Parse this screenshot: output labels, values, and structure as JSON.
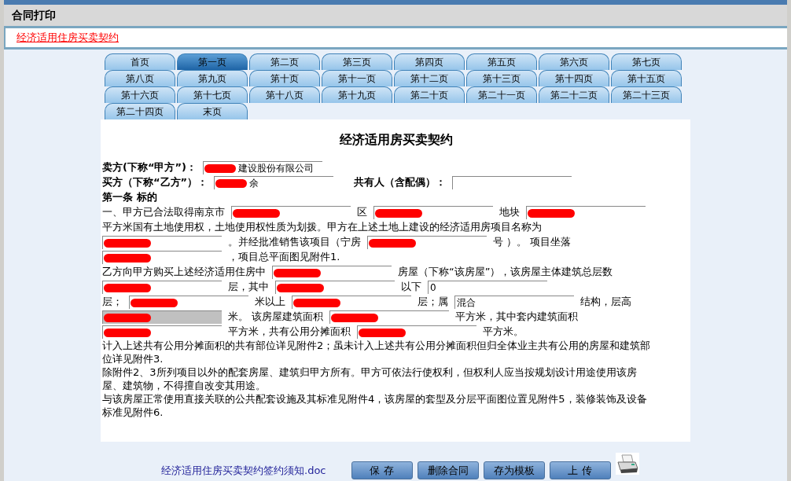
{
  "window": {
    "title": "合同打印"
  },
  "contract_link": "经济适用住房买卖契约",
  "tabs": [
    {
      "label": "首页",
      "selected": false
    },
    {
      "label": "第一页",
      "selected": true
    },
    {
      "label": "第二页",
      "selected": false
    },
    {
      "label": "第三页",
      "selected": false
    },
    {
      "label": "第四页",
      "selected": false
    },
    {
      "label": "第五页",
      "selected": false
    },
    {
      "label": "第六页",
      "selected": false
    },
    {
      "label": "第七页",
      "selected": false
    },
    {
      "label": "第八页",
      "selected": false
    },
    {
      "label": "第九页",
      "selected": false
    },
    {
      "label": "第十页",
      "selected": false
    },
    {
      "label": "第十一页",
      "selected": false
    },
    {
      "label": "第十二页",
      "selected": false
    },
    {
      "label": "第十三页",
      "selected": false
    },
    {
      "label": "第十四页",
      "selected": false
    },
    {
      "label": "第十五页",
      "selected": false
    },
    {
      "label": "第十六页",
      "selected": false
    },
    {
      "label": "第十七页",
      "selected": false
    },
    {
      "label": "第十八页",
      "selected": false
    },
    {
      "label": "第十九页",
      "selected": false
    },
    {
      "label": "第二十页",
      "selected": false
    },
    {
      "label": "第二十一页",
      "selected": false
    },
    {
      "label": "第二十二页",
      "selected": false
    },
    {
      "label": "第二十三页",
      "selected": false
    },
    {
      "label": "第二十四页",
      "selected": false
    },
    {
      "label": "末页",
      "selected": false
    }
  ],
  "document": {
    "title": "经济适用房买卖契约",
    "lines": [
      [
        {
          "kind": "bold",
          "text": "卖方(下称“甲方”)："
        },
        {
          "kind": "field",
          "value": "建设股份有限公司",
          "redacted": true,
          "disabled": false
        }
      ],
      [
        {
          "kind": "bold",
          "text": "买方（下称“乙方”）："
        },
        {
          "kind": "field",
          "value": "余",
          "redacted": true,
          "disabled": false
        },
        {
          "kind": "gap"
        },
        {
          "kind": "bold",
          "text": "共有人（含配偶）："
        },
        {
          "kind": "field",
          "redacted": false,
          "disabled": false
        }
      ],
      [
        {
          "kind": "bold",
          "text": "第一条  标的"
        }
      ],
      [
        {
          "kind": "text",
          "text": "一、甲方已合法取得南京市"
        },
        {
          "kind": "field",
          "redacted": true,
          "disabled": false
        },
        {
          "kind": "text",
          "text": "区"
        },
        {
          "kind": "field",
          "redacted": true,
          "disabled": false
        },
        {
          "kind": "text",
          "text": "地块"
        },
        {
          "kind": "field",
          "redacted": true,
          "disabled": false
        }
      ],
      [
        {
          "kind": "text",
          "text": "平方米国有土地使用权，土地使用权性质为划拨。甲方在上述土地上建设的经济适用房项目名称为"
        }
      ],
      [
        {
          "kind": "field",
          "redacted": true,
          "disabled": false
        },
        {
          "kind": "text",
          "text": "。并经批准销售该项目（宁房"
        },
        {
          "kind": "field",
          "redacted": true,
          "disabled": false
        },
        {
          "kind": "text",
          "text": "号 ）。 项目坐落"
        }
      ],
      [
        {
          "kind": "field",
          "redacted": true,
          "disabled": false
        },
        {
          "kind": "text",
          "text": "，项目总平面图见附件1."
        }
      ],
      [
        {
          "kind": "text",
          "text": "乙方向甲方购买上述经济适用住房中"
        },
        {
          "kind": "field",
          "redacted": true,
          "disabled": false
        },
        {
          "kind": "text",
          "text": "房屋（下称“该房屋”），该房屋主体建筑总层数"
        }
      ],
      [
        {
          "kind": "field",
          "redacted": true,
          "disabled": false
        },
        {
          "kind": "text",
          "text": "层，其中"
        },
        {
          "kind": "field",
          "redacted": true,
          "disabled": false
        },
        {
          "kind": "text",
          "text": "以下"
        },
        {
          "kind": "field",
          "value": "0",
          "redacted": false,
          "disabled": false
        }
      ],
      [
        {
          "kind": "text",
          "text": "层；"
        },
        {
          "kind": "field",
          "redacted": true,
          "disabled": false
        },
        {
          "kind": "text",
          "text": "米以上"
        },
        {
          "kind": "field",
          "redacted": true,
          "disabled": false
        },
        {
          "kind": "text",
          "text": "层；属"
        },
        {
          "kind": "field",
          "value": "混合",
          "redacted": false,
          "disabled": false
        },
        {
          "kind": "text",
          "text": "结构，层高"
        }
      ],
      [
        {
          "kind": "field",
          "redacted": true,
          "disabled": true
        },
        {
          "kind": "text",
          "text": "米。 该房屋建筑面积"
        },
        {
          "kind": "field",
          "redacted": true,
          "disabled": false
        },
        {
          "kind": "text",
          "text": "平方米，其中套内建筑面积"
        }
      ],
      [
        {
          "kind": "field",
          "redacted": true,
          "disabled": false
        },
        {
          "kind": "text",
          "text": "平方米，共有公用分摊面积"
        },
        {
          "kind": "field",
          "redacted": true,
          "disabled": false
        },
        {
          "kind": "text",
          "text": "平方米。"
        }
      ]
    ],
    "paragraphs": [
      "计入上述共有公用分摊面积的共有部位详见附件2；虽未计入上述共有公用分摊面积但归全体业主共有公用的房屋和建筑部位详见附件3.",
      "除附件2、3所列项目以外的配套房屋、建筑归甲方所有。甲方可依法行使权利，但权利人应当按规划设计用途使用该房屋、建筑物，不得擅自改变其用途。",
      "与该房屋正常使用直接关联的公共配套设施及其标准见附件4，该房屋的套型及分层平面图位置见附件5，装修装饰及设备标准见附件6."
    ]
  },
  "footer": {
    "doc_link": "经济适用住房买卖契约签约须知.doc",
    "buttons": [
      "保 存",
      "删除合同",
      "存为模板",
      "上 传"
    ]
  }
}
